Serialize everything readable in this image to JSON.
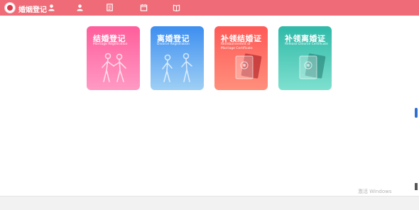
{
  "header": {
    "brand": "婚姻登记",
    "nav": [
      {
        "label": "",
        "icon": "person-icon"
      },
      {
        "label": "",
        "icon": "person-icon"
      },
      {
        "label": "",
        "icon": "document-icon"
      },
      {
        "label": "",
        "icon": "calendar-icon"
      },
      {
        "label": "",
        "icon": "book-icon"
      }
    ],
    "address": ""
  },
  "cards": [
    {
      "title": "结婚登记",
      "subtitle": "Marriage Registration",
      "gradient": [
        "#ff5e9b",
        "#ff9ac4"
      ]
    },
    {
      "title": "离婚登记",
      "subtitle": "Divorce Registration",
      "gradient": [
        "#3d8ef0",
        "#9fd0f5"
      ]
    },
    {
      "title": "补领结婚证",
      "subtitle": "Reimbursement of Marriage Certificate",
      "gradient": [
        "#ff5a57",
        "#ff8f7c"
      ]
    },
    {
      "title": "补领离婚证",
      "subtitle": "Release Divorce Certificate",
      "gradient": [
        "#2fb9a8",
        "#7fe0cf"
      ]
    }
  ],
  "notice": {
    "lines": [
      "",
      "",
      "",
      "",
      "",
      ""
    ]
  },
  "agreement": {
    "text": "",
    "link": ""
  },
  "watermark": "激活 Windows",
  "footer": {
    "text": ""
  },
  "colors": {
    "header_bg": "#ee6b77",
    "link": "#1e6bb8"
  }
}
